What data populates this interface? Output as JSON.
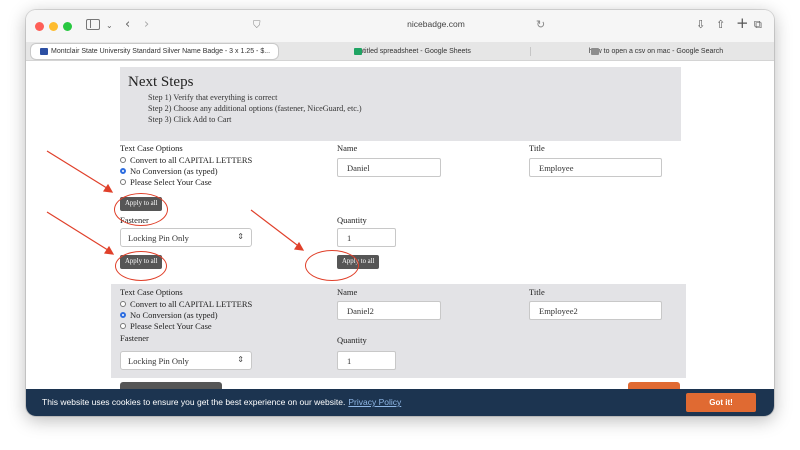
{
  "browser": {
    "url": "nicebadge.com",
    "tabs": [
      {
        "label": "Montclair State University Standard Silver Name Badge - 3 x 1.25 - $..."
      },
      {
        "label": "Untitled spreadsheet - Google Sheets"
      },
      {
        "label": "how to open a csv on mac - Google Search"
      }
    ]
  },
  "next_steps": {
    "title": "Next Steps",
    "steps": [
      "Step 1) Verify that everything is correct",
      "Step 2) Choose any additional options (fastener, NiceGuard, etc.)",
      "Step 3) Click Add to Cart"
    ]
  },
  "badges": [
    {
      "text_case_label": "Text Case Options",
      "options": [
        "Convert to all CAPITAL LETTERS",
        "No Conversion (as typed)",
        "Please Select Your Case"
      ],
      "selected_option": 1,
      "name_label": "Name",
      "name_value": "Daniel",
      "title_label": "Title",
      "title_value": "Employee",
      "fastener_label": "Fastener",
      "fastener_value": "Locking Pin Only",
      "quantity_label": "Quantity",
      "quantity_value": "1",
      "apply_label": "Apply to all"
    },
    {
      "text_case_label": "Text Case Options",
      "options": [
        "Convert to all CAPITAL LETTERS",
        "No Conversion (as typed)",
        "Please Select Your Case"
      ],
      "selected_option": 1,
      "name_label": "Name",
      "name_value": "Daniel2",
      "title_label": "Title",
      "title_value": "Employee2",
      "fastener_label": "Fastener",
      "fastener_value": "Locking Pin Only",
      "quantity_label": "Quantity",
      "quantity_value": "1"
    }
  ],
  "cookie_banner": {
    "message": "This website uses cookies to ensure you get the best experience on our website.",
    "link": "Privacy Policy",
    "button": "Got it!"
  },
  "colors": {
    "annotation": "#e0402a",
    "accent": "#e06a32",
    "banner": "#1c3450"
  },
  "icons": [
    "sidebar-toggle-icon",
    "chevron-down-icon",
    "back-icon",
    "forward-icon",
    "shield-icon",
    "reload-icon",
    "download-icon",
    "share-icon",
    "new-tab-icon",
    "tab-overview-icon"
  ]
}
